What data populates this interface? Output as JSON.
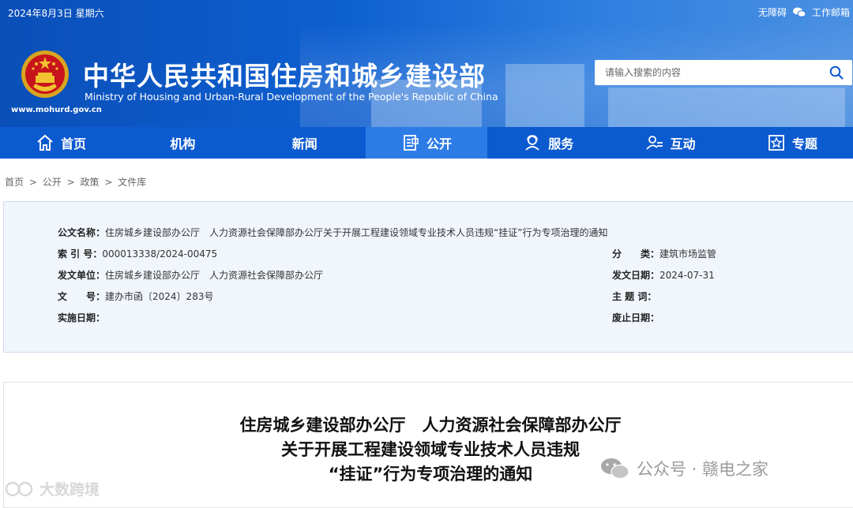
{
  "topbar": {
    "date": "2024年8月3日 星期六",
    "accessibility": "无障碍",
    "mailbox": "工作邮箱"
  },
  "site": {
    "title": "中华人民共和国住房和城乡建设部",
    "subtitle": "Ministry of Housing and Urban-Rural Development of the People's Republic of China",
    "url": "www.mohurd.gov.cn"
  },
  "search": {
    "placeholder": "请输入搜索的内容"
  },
  "nav": {
    "items": [
      {
        "label": "首页",
        "icon": "home-icon"
      },
      {
        "label": "机构",
        "icon": ""
      },
      {
        "label": "新闻",
        "icon": ""
      },
      {
        "label": "公开",
        "icon": "document-icon"
      },
      {
        "label": "服务",
        "icon": "user-service-icon"
      },
      {
        "label": "互动",
        "icon": "interaction-icon"
      },
      {
        "label": "专题",
        "icon": "star-icon"
      }
    ],
    "active": "公开"
  },
  "breadcrumb": [
    "首页",
    ">",
    "公开",
    ">",
    "政策",
    ">",
    "文件库"
  ],
  "info": {
    "doc_name_label": "公文名称：",
    "doc_name": "住房城乡建设部办公厅　人力资源社会保障部办公厅关于开展工程建设领域专业技术人员违规“挂证”行为专项治理的通知",
    "index_label": "索 引 号：",
    "index": "000013338/2024-00475",
    "category_label": "分　　类：",
    "category": "建筑市场监管",
    "issuer_label": "发文单位：",
    "issuer": "住房城乡建设部办公厅　人力资源社会保障部办公厅",
    "issue_date_label": "发文日期：",
    "issue_date": "2024-07-31",
    "doc_no_label": "文　　号：",
    "doc_no": "建办市函〔2024〕283号",
    "keywords_label": "主 题 词：",
    "keywords": "",
    "effective_label": "实施日期：",
    "effective": "",
    "repeal_label": "废止日期：",
    "repeal": ""
  },
  "article": {
    "title_line1": "住房城乡建设部办公厅　人力资源社会保障部办公厅",
    "title_line2": "关于开展工程建设领域专业技术人员违规",
    "title_line3": "“挂证”行为专项治理的通知"
  },
  "watermarks": {
    "left": "大数跨境",
    "right": "公众号 · 赣电之家"
  },
  "colors": {
    "header": "#0e5fd0",
    "nav": "#0c5ad0",
    "nav_active": "#2d7ce6",
    "infobox_bg": "#f1f6fc"
  }
}
